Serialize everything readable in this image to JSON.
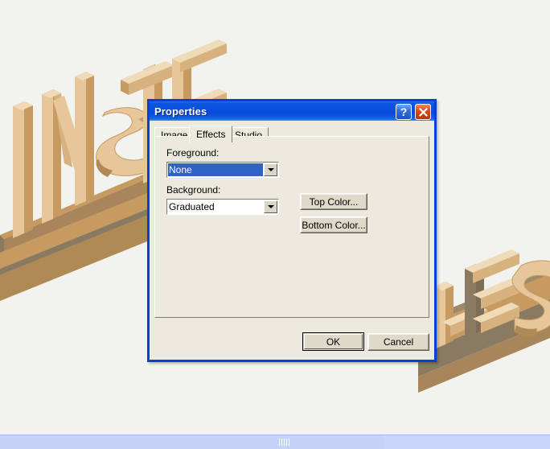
{
  "scene": {
    "name": "3d-text-scene",
    "text_left": "INSTE",
    "text_right": "LES",
    "full_text": "INSTELES",
    "background_color": "#f2f2ee",
    "material_light": "#e7c79a",
    "material_mid": "#c79a62",
    "material_dark": "#8b7a62"
  },
  "dialog": {
    "title": "Properties",
    "titlebar_color": "#0a4fe0",
    "border_color": "#0a3fd4",
    "face_color": "#eceade",
    "help_button": "?",
    "help_icon": "question-mark-icon",
    "close_button": "✕",
    "close_icon": "close-x-icon",
    "tabs": [
      {
        "label": "Image",
        "active": false
      },
      {
        "label": "Effects",
        "active": true
      },
      {
        "label": "Studio",
        "active": false
      }
    ],
    "effects": {
      "foreground_label": "Foreground:",
      "foreground_value": "None",
      "foreground_focused": true,
      "background_label": "Background:",
      "background_value": "Graduated",
      "top_color_button": "Top Color...",
      "bottom_color_button": "Bottom Color...",
      "selection_color": "#2e62c4"
    },
    "footer": {
      "ok_button": "OK",
      "cancel_button": "Cancel",
      "default_button": "OK"
    }
  },
  "bottom_bar": {
    "name": "horizontal-scrollbar",
    "track_color": "#c9d6fa",
    "thumb_color": "#c5d3f8",
    "grip": "||||"
  }
}
